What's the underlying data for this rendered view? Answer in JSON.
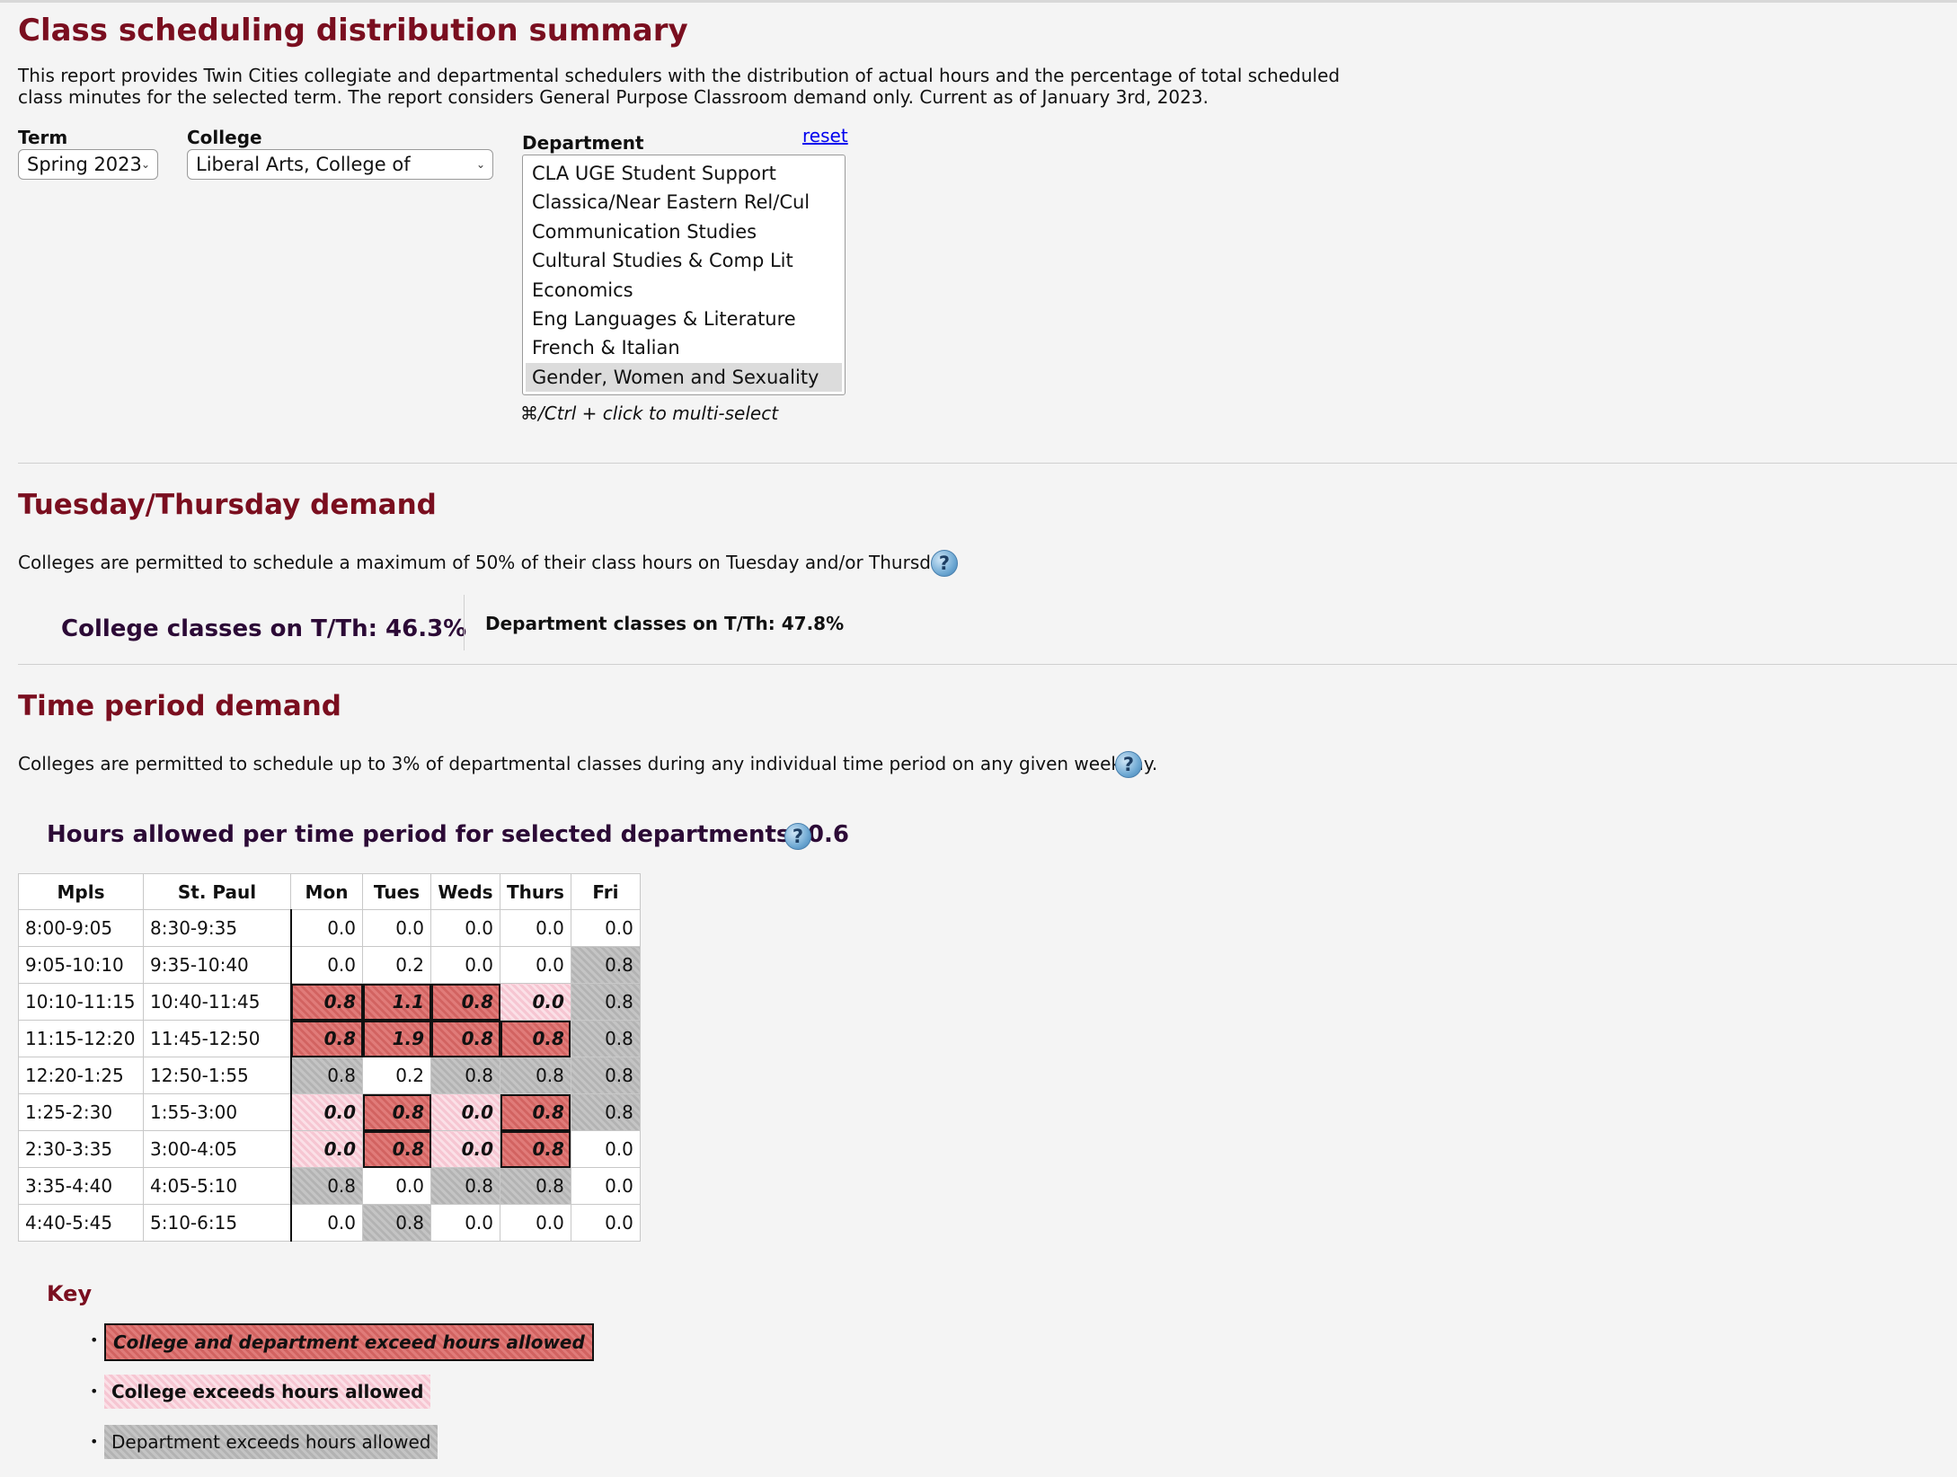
{
  "page": {
    "title": "Class scheduling distribution summary",
    "intro": "This report provides Twin Cities collegiate and departmental schedulers with the distribution of actual hours and the percentage of total scheduled class minutes for the selected term. The report considers General Purpose Classroom demand only. Current as of January 3rd, 2023."
  },
  "filters": {
    "term_label": "Term",
    "term_value": "Spring 2023",
    "college_label": "College",
    "college_value": "Liberal Arts, College of",
    "department_label": "Department",
    "reset_label": "reset",
    "departments": [
      "CLA UGE Student Support",
      "Classica/Near Eastern Rel/Cul",
      "Communication Studies",
      "Cultural Studies & Comp Lit",
      "Economics",
      "Eng Languages & Literature",
      "French & Italian",
      "Gender, Women and Sexuality"
    ],
    "selected_department": "Gender, Women and Sexuality",
    "multi_select_hint": "⌘/Ctrl + click to multi-select"
  },
  "tt_demand": {
    "title": "Tuesday/Thursday demand",
    "description": "Colleges are permitted to schedule a maximum of 50% of their class hours on Tuesday and/or Thursday.",
    "college_stat": "College classes on T/Th: 46.3%",
    "department_stat": "Department classes on T/Th: 47.8%"
  },
  "time_demand": {
    "title": "Time period demand",
    "description": "Colleges are permitted to schedule up to 3% of departmental classes during any individual time period on any given weekday.",
    "hours_allowed": "Hours allowed per time period for selected departments: 0.6",
    "headers": [
      "Mpls",
      "St. Paul",
      "Mon",
      "Tues",
      "Weds",
      "Thurs",
      "Fri"
    ],
    "rows": [
      {
        "mpls": "8:00-9:05",
        "stpaul": "8:30-9:35",
        "cells": [
          {
            "v": "0.0",
            "s": "n"
          },
          {
            "v": "0.0",
            "s": "n"
          },
          {
            "v": "0.0",
            "s": "n"
          },
          {
            "v": "0.0",
            "s": "n"
          },
          {
            "v": "0.0",
            "s": "n"
          }
        ]
      },
      {
        "mpls": "9:05-10:10",
        "stpaul": "9:35-10:40",
        "cells": [
          {
            "v": "0.0",
            "s": "n"
          },
          {
            "v": "0.2",
            "s": "n"
          },
          {
            "v": "0.0",
            "s": "n"
          },
          {
            "v": "0.0",
            "s": "n"
          },
          {
            "v": "0.8",
            "s": "dept"
          }
        ]
      },
      {
        "mpls": "10:10-11:15",
        "stpaul": "10:40-11:45",
        "cells": [
          {
            "v": "0.8",
            "s": "both"
          },
          {
            "v": "1.1",
            "s": "both"
          },
          {
            "v": "0.8",
            "s": "both"
          },
          {
            "v": "0.0",
            "s": "coll"
          },
          {
            "v": "0.8",
            "s": "dept"
          }
        ]
      },
      {
        "mpls": "11:15-12:20",
        "stpaul": "11:45-12:50",
        "cells": [
          {
            "v": "0.8",
            "s": "both"
          },
          {
            "v": "1.9",
            "s": "both"
          },
          {
            "v": "0.8",
            "s": "both"
          },
          {
            "v": "0.8",
            "s": "both"
          },
          {
            "v": "0.8",
            "s": "dept"
          }
        ]
      },
      {
        "mpls": "12:20-1:25",
        "stpaul": "12:50-1:55",
        "cells": [
          {
            "v": "0.8",
            "s": "dept"
          },
          {
            "v": "0.2",
            "s": "n"
          },
          {
            "v": "0.8",
            "s": "dept"
          },
          {
            "v": "0.8",
            "s": "dept"
          },
          {
            "v": "0.8",
            "s": "dept"
          }
        ]
      },
      {
        "mpls": "1:25-2:30",
        "stpaul": "1:55-3:00",
        "cells": [
          {
            "v": "0.0",
            "s": "coll"
          },
          {
            "v": "0.8",
            "s": "both"
          },
          {
            "v": "0.0",
            "s": "coll"
          },
          {
            "v": "0.8",
            "s": "both"
          },
          {
            "v": "0.8",
            "s": "dept"
          }
        ]
      },
      {
        "mpls": "2:30-3:35",
        "stpaul": "3:00-4:05",
        "cells": [
          {
            "v": "0.0",
            "s": "coll"
          },
          {
            "v": "0.8",
            "s": "both"
          },
          {
            "v": "0.0",
            "s": "coll"
          },
          {
            "v": "0.8",
            "s": "both"
          },
          {
            "v": "0.0",
            "s": "n"
          }
        ]
      },
      {
        "mpls": "3:35-4:40",
        "stpaul": "4:05-5:10",
        "cells": [
          {
            "v": "0.8",
            "s": "dept"
          },
          {
            "v": "0.0",
            "s": "n"
          },
          {
            "v": "0.8",
            "s": "dept"
          },
          {
            "v": "0.8",
            "s": "dept"
          },
          {
            "v": "0.0",
            "s": "n"
          }
        ]
      },
      {
        "mpls": "4:40-5:45",
        "stpaul": "5:10-6:15",
        "cells": [
          {
            "v": "0.0",
            "s": "n"
          },
          {
            "v": "0.8",
            "s": "dept"
          },
          {
            "v": "0.0",
            "s": "n"
          },
          {
            "v": "0.0",
            "s": "n"
          },
          {
            "v": "0.0",
            "s": "n"
          }
        ]
      }
    ]
  },
  "key": {
    "title": "Key",
    "both": "College and department exceed hours allowed",
    "college": "College exceeds hours allowed",
    "department": "Department exceeds hours allowed"
  },
  "icons": {
    "help": "help-question-icon",
    "dropdown": "chevron-down-icon"
  },
  "colors": {
    "heading": "#7a0e1f",
    "both": "#d96b69",
    "college": "#f6c6d2",
    "department": "#bdbdbd"
  }
}
